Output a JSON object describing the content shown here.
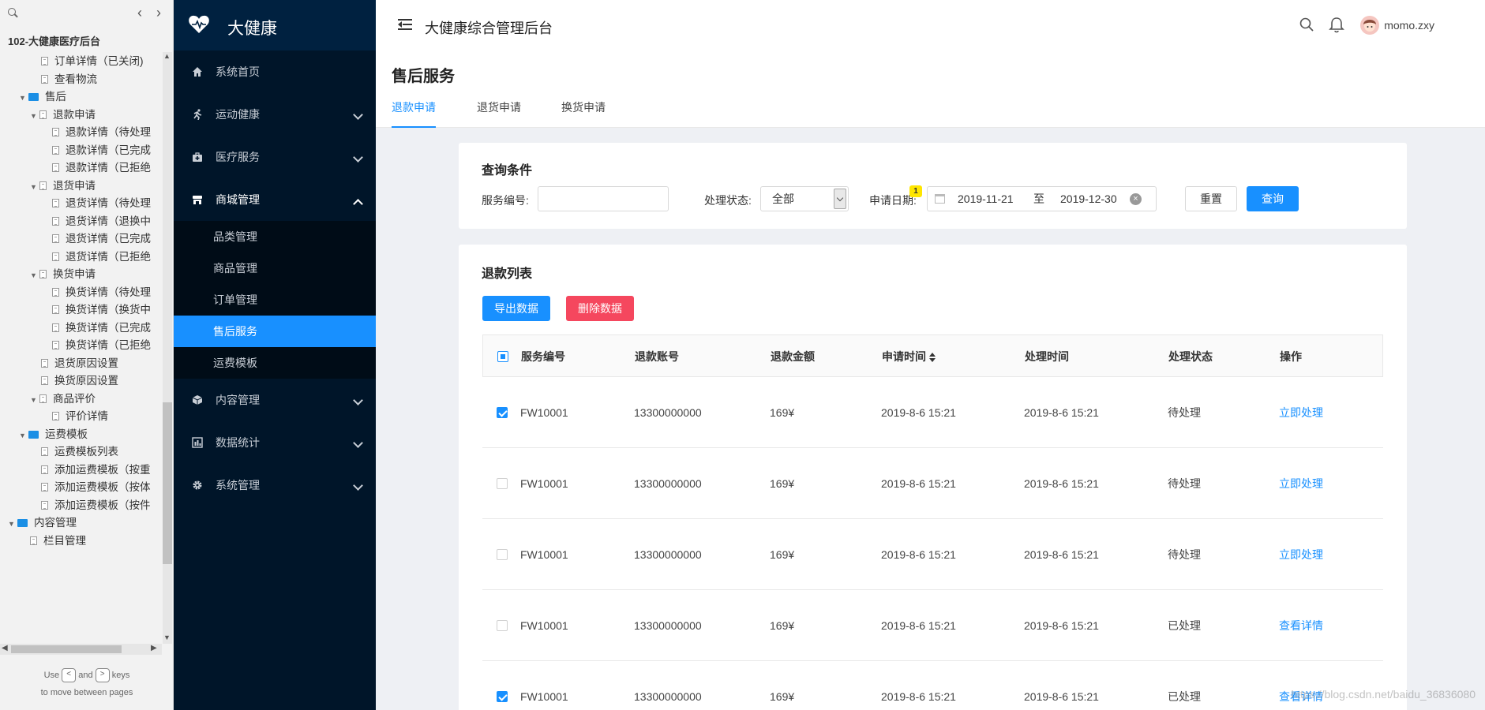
{
  "pagetree": {
    "title": "102-大健康医疗后台",
    "items": [
      {
        "label": "订单详情（已关闭)",
        "indent": 2,
        "kind": "page",
        "toggle": ""
      },
      {
        "label": "查看物流",
        "indent": 2,
        "kind": "page",
        "toggle": ""
      },
      {
        "label": "售后",
        "indent": 1,
        "kind": "folder",
        "toggle": "▼"
      },
      {
        "label": "退款申请",
        "indent": 2,
        "kind": "page",
        "toggle": "▼"
      },
      {
        "label": "退款详情（待处理",
        "indent": 3,
        "kind": "page",
        "toggle": ""
      },
      {
        "label": "退款详情（已完成",
        "indent": 3,
        "kind": "page",
        "toggle": ""
      },
      {
        "label": "退款详情（已拒绝",
        "indent": 3,
        "kind": "page",
        "toggle": ""
      },
      {
        "label": "退货申请",
        "indent": 2,
        "kind": "page",
        "toggle": "▼"
      },
      {
        "label": "退货详情（待处理",
        "indent": 3,
        "kind": "page",
        "toggle": ""
      },
      {
        "label": "退货详情（退换中",
        "indent": 3,
        "kind": "page",
        "toggle": ""
      },
      {
        "label": "退货详情（已完成",
        "indent": 3,
        "kind": "page",
        "toggle": ""
      },
      {
        "label": "退货详情（已拒绝",
        "indent": 3,
        "kind": "page",
        "toggle": ""
      },
      {
        "label": "换货申请",
        "indent": 2,
        "kind": "page",
        "toggle": "▼"
      },
      {
        "label": "换货详情（待处理",
        "indent": 3,
        "kind": "page",
        "toggle": ""
      },
      {
        "label": "换货详情（换货中",
        "indent": 3,
        "kind": "page",
        "toggle": ""
      },
      {
        "label": "换货详情（已完成",
        "indent": 3,
        "kind": "page",
        "toggle": ""
      },
      {
        "label": "换货详情（已拒绝",
        "indent": 3,
        "kind": "page",
        "toggle": ""
      },
      {
        "label": "退货原因设置",
        "indent": 2,
        "kind": "page",
        "toggle": ""
      },
      {
        "label": "换货原因设置",
        "indent": 2,
        "kind": "page",
        "toggle": ""
      },
      {
        "label": "商品评价",
        "indent": 2,
        "kind": "page",
        "toggle": "▼"
      },
      {
        "label": "评价详情",
        "indent": 3,
        "kind": "page",
        "toggle": ""
      },
      {
        "label": "运费模板",
        "indent": 1,
        "kind": "folder",
        "toggle": "▼"
      },
      {
        "label": "运费模板列表",
        "indent": 2,
        "kind": "page",
        "toggle": ""
      },
      {
        "label": "添加运费模板（按重",
        "indent": 2,
        "kind": "page",
        "toggle": ""
      },
      {
        "label": "添加运费模板（按体",
        "indent": 2,
        "kind": "page",
        "toggle": ""
      },
      {
        "label": "添加运费模板（按件",
        "indent": 2,
        "kind": "page",
        "toggle": ""
      },
      {
        "label": "内容管理",
        "indent": 0,
        "kind": "folder",
        "toggle": "▼"
      },
      {
        "label": "栏目管理",
        "indent": 1,
        "kind": "page",
        "toggle": ""
      }
    ],
    "hint": {
      "use": "Use",
      "and": "and",
      "keys": "keys",
      "line2": "to move between pages",
      "key_prev": "<",
      "key_next": ">"
    }
  },
  "sidebar": {
    "brand": "大健康",
    "menu": [
      {
        "label": "系统首页",
        "icon": "home-icon",
        "has_children": false,
        "open": false
      },
      {
        "label": "运动健康",
        "icon": "running-icon",
        "has_children": true,
        "open": false
      },
      {
        "label": "医疗服务",
        "icon": "medical-kit-icon",
        "has_children": true,
        "open": false
      },
      {
        "label": "商城管理",
        "icon": "shop-icon",
        "has_children": true,
        "open": true
      },
      {
        "label": "内容管理",
        "icon": "cube-icon",
        "has_children": true,
        "open": false
      },
      {
        "label": "数据统计",
        "icon": "bar-chart-icon",
        "has_children": true,
        "open": false
      },
      {
        "label": "系统管理",
        "icon": "gear-icon",
        "has_children": true,
        "open": false
      }
    ],
    "submenu": [
      {
        "label": "品类管理",
        "active": false
      },
      {
        "label": "商品管理",
        "active": false
      },
      {
        "label": "订单管理",
        "active": false
      },
      {
        "label": "售后服务",
        "active": true
      },
      {
        "label": "运费模板",
        "active": false
      }
    ]
  },
  "header": {
    "title": "大健康综合管理后台",
    "username": "momo.zxy"
  },
  "page": {
    "title": "售后服务",
    "tabs": [
      {
        "label": "退款申请",
        "active": true
      },
      {
        "label": "退货申请",
        "active": false
      },
      {
        "label": "换货申请",
        "active": false
      }
    ]
  },
  "query": {
    "title": "查询条件",
    "service_no_label": "服务编号:",
    "service_no_value": "",
    "status_label": "处理状态:",
    "status_value": "全部",
    "date_label": "申请日期:",
    "date_badge": "1",
    "date_start": "2019-11-21",
    "date_sep": "至",
    "date_end": "2019-12-30",
    "reset_label": "重置",
    "search_label": "查询"
  },
  "list": {
    "title": "退款列表",
    "export_label": "导出数据",
    "delete_label": "删除数据",
    "columns": [
      "服务编号",
      "退款账号",
      "退款金额",
      "申请时间",
      "处理时间",
      "处理状态",
      "操作"
    ],
    "rows": [
      {
        "checked": true,
        "no": "FW10001",
        "account": "13300000000",
        "amount": "169¥",
        "apply_time": "2019-8-6 15:21",
        "handle_time": "2019-8-6 15:21",
        "status": "待处理",
        "action": "立即处理"
      },
      {
        "checked": false,
        "no": "FW10001",
        "account": "13300000000",
        "amount": "169¥",
        "apply_time": "2019-8-6 15:21",
        "handle_time": "2019-8-6 15:21",
        "status": "待处理",
        "action": "立即处理"
      },
      {
        "checked": false,
        "no": "FW10001",
        "account": "13300000000",
        "amount": "169¥",
        "apply_time": "2019-8-6 15:21",
        "handle_time": "2019-8-6 15:21",
        "status": "待处理",
        "action": "立即处理"
      },
      {
        "checked": false,
        "no": "FW10001",
        "account": "13300000000",
        "amount": "169¥",
        "apply_time": "2019-8-6 15:21",
        "handle_time": "2019-8-6 15:21",
        "status": "已处理",
        "action": "查看详情"
      },
      {
        "checked": true,
        "no": "FW10001",
        "account": "13300000000",
        "amount": "169¥",
        "apply_time": "2019-8-6 15:21",
        "handle_time": "2019-8-6 15:21",
        "status": "已处理",
        "action": "查看详情"
      }
    ]
  },
  "watermark": "https://blog.csdn.net/baidu_36836080"
}
